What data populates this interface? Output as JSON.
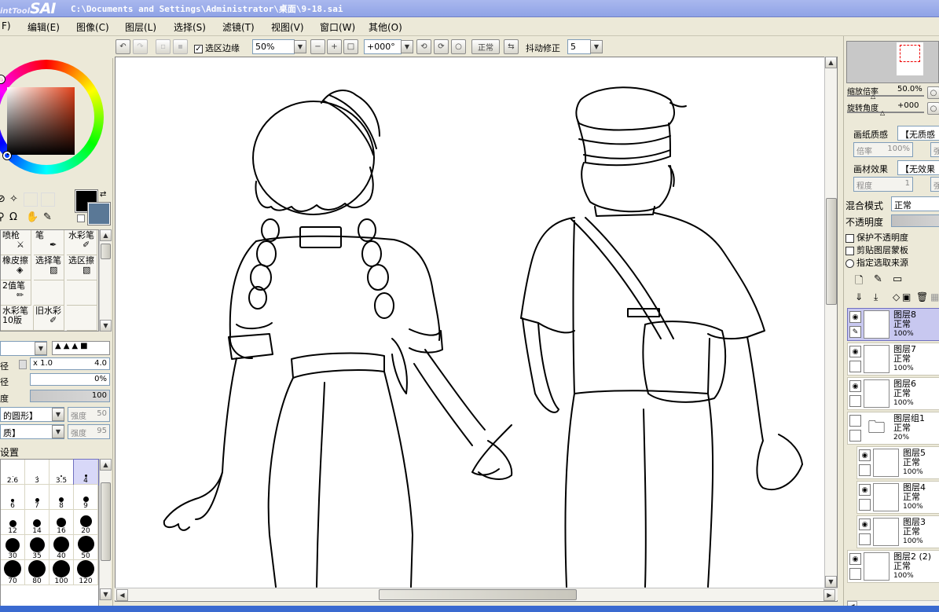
{
  "title_bar": {
    "logo_small": "intTool",
    "logo_big": "SAI",
    "file_path": "C:\\Documents and Settings\\Administrator\\桌面\\9-18.sai"
  },
  "menu": [
    {
      "label": "F)"
    },
    {
      "label": "编辑(E)"
    },
    {
      "label": "图像(C)"
    },
    {
      "label": "图层(L)"
    },
    {
      "label": "选择(S)"
    },
    {
      "label": "滤镜(T)"
    },
    {
      "label": "视图(V)"
    },
    {
      "label": "窗口(W)"
    },
    {
      "label": "其他(O)"
    }
  ],
  "toolbar": {
    "selection_edge_label": "选区边缘",
    "selection_edge_checked": true,
    "zoom_value": "50%",
    "rotation_value": "+000°",
    "blend_mode": "正常",
    "stabilizer_label": "抖动修正",
    "stabilizer_value": "5"
  },
  "left_panel": {
    "tools": [
      {
        "label": "喷枪"
      },
      {
        "label": "笔"
      },
      {
        "label": "水彩笔"
      },
      {
        "label": "橡皮擦"
      },
      {
        "label": "选择笔"
      },
      {
        "label": "选区擦"
      },
      {
        "label": "2值笔"
      },
      {
        "label": ""
      },
      {
        "label": ""
      },
      {
        "label": "水彩笔10版"
      },
      {
        "label": "旧水彩"
      },
      {
        "label": ""
      }
    ],
    "size_label": "径",
    "size_multiplier": "x 1.0",
    "size_value": "4.0",
    "min_size_label": "径",
    "min_size_value": "0%",
    "density_label": "度",
    "density_value": "100",
    "shape_label": "的圆形】",
    "shape_strength_label": "强度",
    "shape_strength_value": "50",
    "texture_label": "质】",
    "texture_strength_label": "强度",
    "texture_strength_value": "95",
    "settings_label": "设置",
    "brush_sizes": [
      "2.6",
      "3",
      "3.5",
      "4",
      "6",
      "7",
      "8",
      "9",
      "12",
      "14",
      "16",
      "20",
      "30",
      "35",
      "40",
      "50",
      "70",
      "80",
      "100",
      "120"
    ],
    "selected_brush_size": "4"
  },
  "right_panel": {
    "zoom_label": "缩放倍率",
    "zoom_value": "50.0%",
    "angle_label": "旋转角度",
    "angle_value": "+000",
    "paper_texture_label": "画纸质感",
    "paper_texture_value": "【无质感",
    "paper_rate_label": "倍率",
    "paper_rate_value": "100%",
    "paper_strength_label": "强",
    "material_label": "画材效果",
    "material_value": "【无效果",
    "material_degree_label": "程度",
    "material_degree_value": "1",
    "material_strength_label": "强",
    "blend_label": "混合模式",
    "blend_value": "正常",
    "opacity_label": "不透明度",
    "protect_opacity_label": "保护不透明度",
    "clip_mask_label": "剪贴图层蒙板",
    "select_source_label": "指定选取来源",
    "layers": [
      {
        "name": "图层8",
        "mode": "正常",
        "opacity": "100%",
        "selected": true
      },
      {
        "name": "图层7",
        "mode": "正常",
        "opacity": "100%"
      },
      {
        "name": "图层6",
        "mode": "正常",
        "opacity": "100%"
      },
      {
        "name": "图层组1",
        "mode": "正常",
        "opacity": "20%",
        "folder": true
      },
      {
        "name": "图层5",
        "mode": "正常",
        "opacity": "100%"
      },
      {
        "name": "图层4",
        "mode": "正常",
        "opacity": "100%"
      },
      {
        "name": "图层3",
        "mode": "正常",
        "opacity": "100%"
      },
      {
        "name": "图层2 (2)",
        "mode": "正常",
        "opacity": "100%"
      }
    ]
  },
  "colors": {
    "primary": "#000000",
    "secondary": "#5a7896"
  }
}
